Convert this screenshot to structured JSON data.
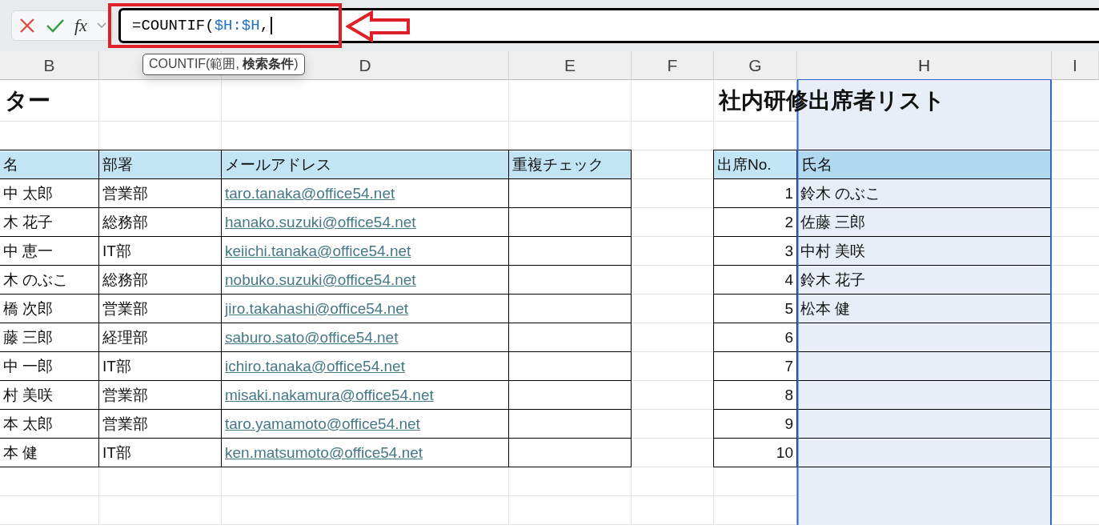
{
  "formula_bar": {
    "function_label": "fx",
    "formula": [
      {
        "text": "=COUNTIF(",
        "kind": "plain"
      },
      {
        "text": "$H:$H",
        "kind": "ref"
      },
      {
        "text": ",",
        "kind": "plain"
      }
    ],
    "tooltip": "COUNTIF(範囲, **検索条件**)"
  },
  "columns": [
    {
      "label": "B",
      "selected": false
    },
    {
      "selected": false
    },
    {
      "label": "D",
      "selected": false
    },
    {
      "label": "E",
      "selected": false
    },
    {
      "label": "F",
      "selected": false
    },
    {
      "label": "G",
      "selected": false
    },
    {
      "label": "H",
      "selected": true
    },
    {
      "label": "I",
      "selected": false
    }
  ],
  "staff_table": {
    "title": "ター",
    "headers": [
      "名",
      "部署",
      "メールアドレス",
      "重複チェック"
    ],
    "rows": [
      {
        "name": "中 太郎",
        "department": "営業部",
        "email": "taro.tanaka@office54.net"
      },
      {
        "name": "木 花子",
        "department": "総務部",
        "email": "hanako.suzuki@office54.net"
      },
      {
        "name": "中 恵一",
        "department": "IT部",
        "email": "keiichi.tanaka@office54.net"
      },
      {
        "name": "木 のぶこ",
        "department": "総務部",
        "email": "nobuko.suzuki@office54.net"
      },
      {
        "name": "橋 次郎",
        "department": "営業部",
        "email": "jiro.takahashi@office54.net"
      },
      {
        "name": "藤 三郎",
        "department": "経理部",
        "email": "saburo.sato@office54.net"
      },
      {
        "name": "中 一郎",
        "department": "IT部",
        "email": "ichiro.tanaka@office54.net"
      },
      {
        "name": "村 美咲",
        "department": "営業部",
        "email": "misaki.nakamura@office54.net"
      },
      {
        "name": "本 太郎",
        "department": "営業部",
        "email": "taro.yamamoto@office54.net"
      },
      {
        "name": "本 健",
        "department": "IT部",
        "email": "ken.matsumoto@office54.net"
      }
    ]
  },
  "attendance_table": {
    "title": "社内研修出席者リスト",
    "headers": [
      "出席No.",
      "氏名"
    ],
    "rows": [
      {
        "no": "1",
        "name": "鈴木 のぶこ"
      },
      {
        "no": "2",
        "name": "佐藤 三郎"
      },
      {
        "no": "3",
        "name": "中村 美咲"
      },
      {
        "no": "4",
        "name": "鈴木 花子"
      },
      {
        "no": "5",
        "name": "松本 健"
      },
      {
        "no": "6"
      },
      {
        "no": "7"
      },
      {
        "no": "8"
      },
      {
        "no": "9"
      },
      {
        "no": "10"
      }
    ]
  }
}
